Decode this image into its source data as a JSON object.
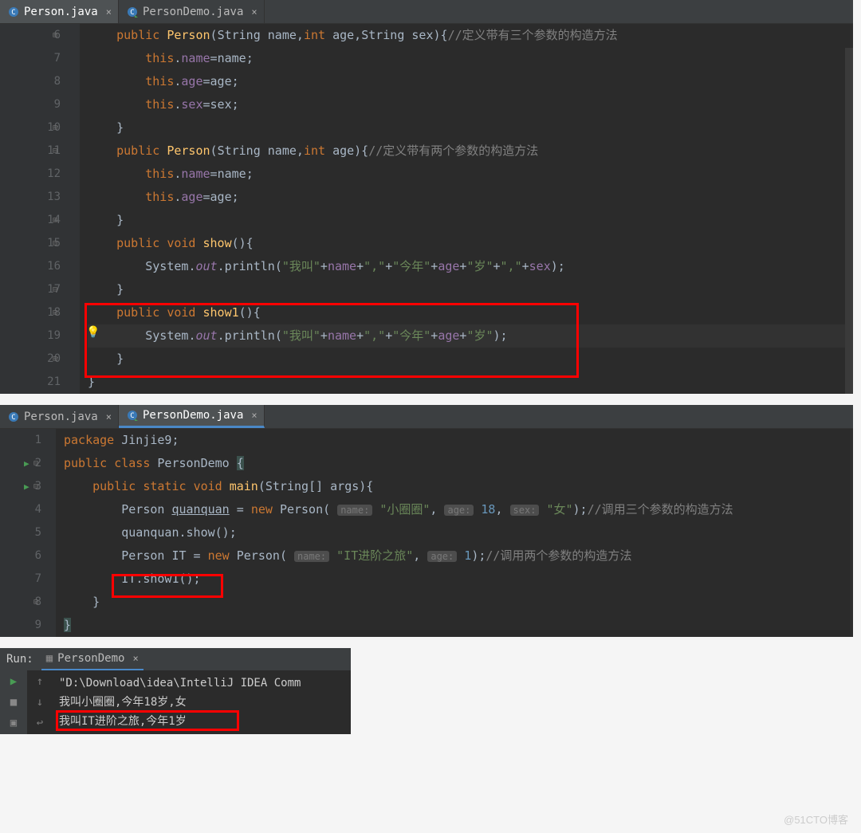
{
  "panel1": {
    "tabs": [
      {
        "label": "Person.java",
        "active": true
      },
      {
        "label": "PersonDemo.java",
        "active": false
      }
    ],
    "lines": {
      "l6": {
        "num": "6"
      },
      "l7": {
        "num": "7"
      },
      "l8": {
        "num": "8"
      },
      "l9": {
        "num": "9"
      },
      "l10": {
        "num": "10"
      },
      "l11": {
        "num": "11"
      },
      "l12": {
        "num": "12"
      },
      "l13": {
        "num": "13"
      },
      "l14": {
        "num": "14"
      },
      "l15": {
        "num": "15"
      },
      "l16": {
        "num": "16"
      },
      "l17": {
        "num": "17"
      },
      "l18": {
        "num": "18"
      },
      "l19": {
        "num": "19"
      },
      "l20": {
        "num": "20"
      },
      "l21": {
        "num": "21"
      }
    },
    "tokens": {
      "public": "public",
      "Person": "Person",
      "String": "String",
      "name": "name",
      "int": "int",
      "age": "age",
      "sex": "sex",
      "this": "this",
      "void": "void",
      "show": "show",
      "show1": "show1",
      "System": "System",
      "out": "out",
      "println": "println",
      "cmt3": "//定义带有三个参数的构造方法",
      "cmt2": "//定义带有两个参数的构造方法",
      "s_woj": "\"我叫\"",
      "s_comma": "\",\"",
      "s_jinnian": "\"今年\"",
      "s_sui": "\"岁\""
    }
  },
  "panel2": {
    "tabs": [
      {
        "label": "Person.java",
        "active": false
      },
      {
        "label": "PersonDemo.java",
        "active": true
      }
    ],
    "lines": {
      "l1": {
        "num": "1"
      },
      "l2": {
        "num": "2"
      },
      "l3": {
        "num": "3"
      },
      "l4": {
        "num": "4"
      },
      "l5": {
        "num": "5"
      },
      "l6": {
        "num": "6"
      },
      "l7": {
        "num": "7"
      },
      "l8": {
        "num": "8"
      },
      "l9": {
        "num": "9"
      }
    },
    "tokens": {
      "package": "package",
      "Jinjie9": "Jinjie9",
      "public": "public",
      "class": "class",
      "PersonDemo": "PersonDemo",
      "static": "static",
      "void": "void",
      "main": "main",
      "String": "String",
      "args": "args",
      "Person": "Person",
      "quanquan": "quanquan",
      "new": "new",
      "show": "show",
      "IT": "IT",
      "show1": "show1",
      "hint_name": "name:",
      "hint_age": "age:",
      "hint_sex": "sex:",
      "s_xqq": "\"小圈圈\"",
      "s_nv": "\"女\"",
      "s_itjz": "\"IT进阶之旅\"",
      "n18": "18",
      "n1": "1",
      "cmt3": "//调用三个参数的构造方法",
      "cmt2": "//调用两个参数的构造方法"
    }
  },
  "run": {
    "label_run": "Run:",
    "config": "PersonDemo",
    "out1": "\"D:\\Download\\idea\\IntelliJ IDEA Comm",
    "out2": "我叫小圈圈,今年18岁,女",
    "out3": "我叫IT进阶之旅,今年1岁"
  },
  "watermark": "@51CTO博客"
}
